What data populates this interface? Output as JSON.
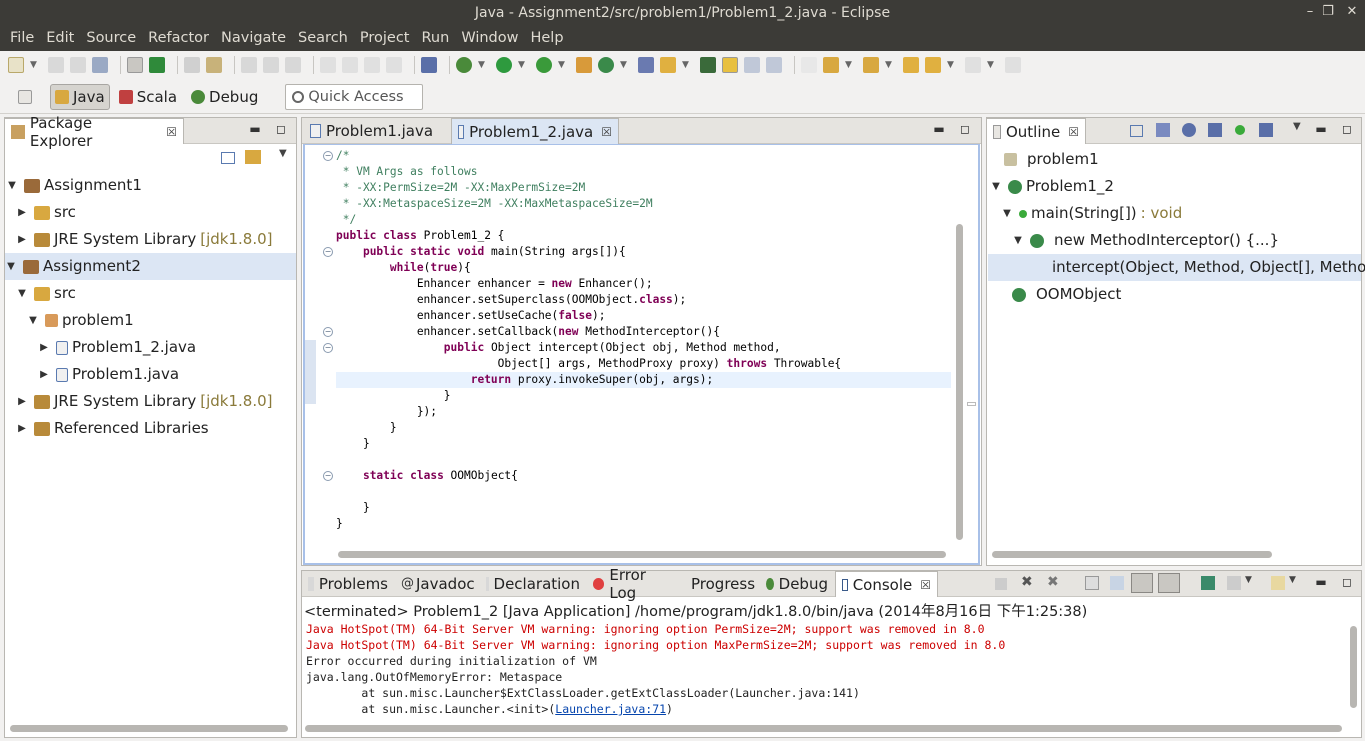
{
  "window": {
    "title": "Java - Assignment2/src/problem1/Problem1_2.java - Eclipse"
  },
  "menu": [
    "File",
    "Edit",
    "Source",
    "Refactor",
    "Navigate",
    "Search",
    "Project",
    "Run",
    "Window",
    "Help"
  ],
  "perspectives": {
    "java": "Java",
    "scala": "Scala",
    "debug": "Debug",
    "quick_access": "Quick Access"
  },
  "package_explorer": {
    "tab": "Package Explorer",
    "rows": {
      "a1": "Assignment1",
      "a1_src": "src",
      "a1_jre": "JRE System Library",
      "a1_jre_decor": "[jdk1.8.0]",
      "a2": "Assignment2",
      "a2_src": "src",
      "a2_pkg": "problem1",
      "a2_f1": "Problem1_2.java",
      "a2_f2": "Problem1.java",
      "a2_jre": "JRE System Library",
      "a2_jre_decor": "[jdk1.8.0]",
      "a2_ref": "Referenced Libraries"
    }
  },
  "editor": {
    "tabs": [
      "Problem1.java",
      "Problem1_2.java"
    ],
    "lines": [
      "/*",
      " * VM Args as follows",
      " * -XX:PermSize=2M -XX:MaxPermSize=2M",
      " * -XX:MetaspaceSize=2M -XX:MaxMetaspaceSize=2M",
      " */",
      "public class Problem1_2 {",
      "    public static void main(String args[]){",
      "        while(true){",
      "            Enhancer enhancer = new Enhancer();",
      "            enhancer.setSuperclass(OOMObject.class);",
      "            enhancer.setUseCache(false);",
      "            enhancer.setCallback(new MethodInterceptor(){",
      "                public Object intercept(Object obj, Method method,",
      "                        Object[] args, MethodProxy proxy) throws Throwable{",
      "                    return proxy.invokeSuper(obj, args);",
      "                }",
      "            });",
      "        }",
      "    }",
      "",
      "    static class OOMObject{",
      "",
      "    }",
      "}"
    ]
  },
  "outline": {
    "tab": "Outline",
    "rows": {
      "pkg": "problem1",
      "cls": "Problem1_2",
      "main": "main(String[])",
      "main_ret": ": void",
      "anon": "new MethodInterceptor() {...}",
      "intercept": "intercept(Object, Method, Object[], Method",
      "oom": "OOMObject"
    }
  },
  "bottom": {
    "tabs": [
      "Problems",
      "Javadoc",
      "Declaration",
      "Error Log",
      "Progress",
      "Debug",
      "Console"
    ],
    "header": "<terminated> Problem1_2 [Java Application] /home/program/jdk1.8.0/bin/java (2014年8月16日 下午1:25:38)",
    "lines": [
      "Java HotSpot(TM) 64-Bit Server VM warning: ignoring option PermSize=2M; support was removed in 8.0",
      "Java HotSpot(TM) 64-Bit Server VM warning: ignoring option MaxPermSize=2M; support was removed in 8.0",
      "Error occurred during initialization of VM",
      "java.lang.OutOfMemoryError: Metaspace",
      "\tat sun.misc.Launcher$ExtClassLoader.getExtClassLoader(Launcher.java:141)",
      "\tat sun.misc.Launcher.<init>("
    ],
    "link": "Launcher.java:71",
    "tail": ")"
  }
}
